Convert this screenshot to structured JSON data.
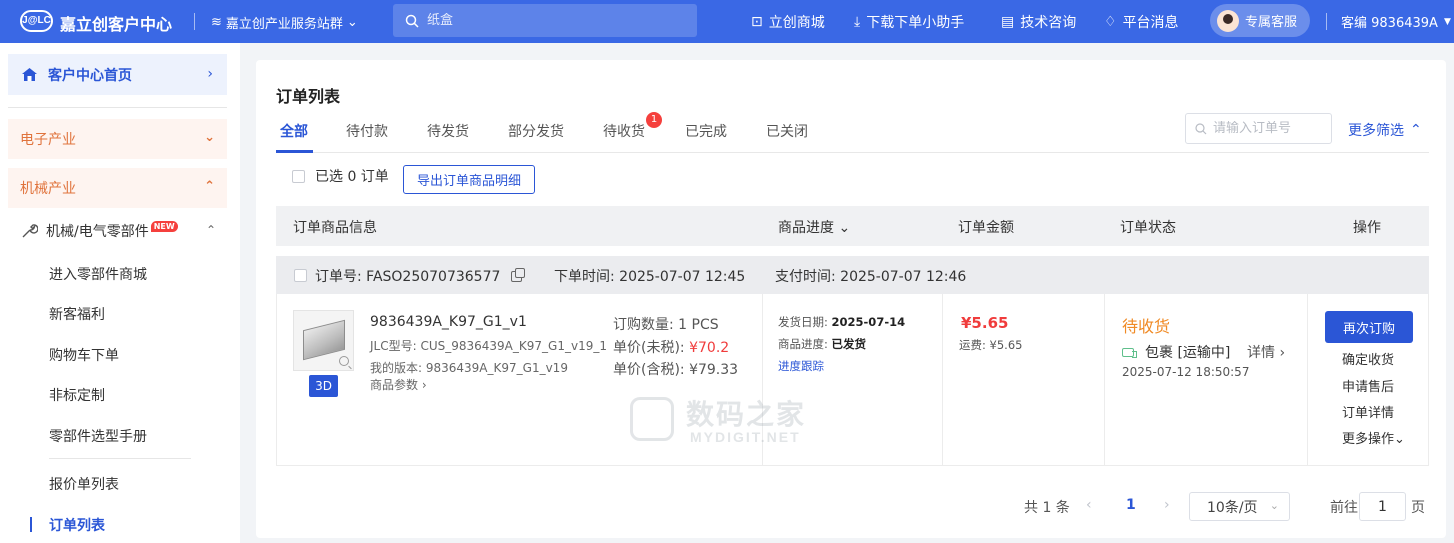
{
  "topbar": {
    "logo_text": "J@LC",
    "brand": "嘉立创客户中心",
    "site_switch": "嘉立创产业服务站群",
    "search_placeholder": "纸盒",
    "nav": [
      "立创商城",
      "下载下单小助手",
      "技术咨询",
      "平台消息"
    ],
    "service": "专属客服",
    "account": "客编 9836439A"
  },
  "sidebar": {
    "home": "客户中心首页",
    "categories": [
      "电子产业",
      "机械产业"
    ],
    "group": "机械/电气零部件",
    "new_badge": "NEW",
    "items": [
      "进入零部件商城",
      "新客福利",
      "购物车下单",
      "非标定制",
      "零部件选型手册"
    ],
    "items2": [
      "报价单列表",
      "订单列表"
    ]
  },
  "main": {
    "title": "订单列表",
    "tabs": [
      "全部",
      "待付款",
      "待发货",
      "部分发货",
      "待收货",
      "已完成",
      "已关闭"
    ],
    "tab_badge": "1",
    "order_search_placeholder": "请输入订单号",
    "more_filter": "更多筛选",
    "selected": "已选 0 订单",
    "export": "导出订单商品明细",
    "columns": [
      "订单商品信息",
      "商品进度",
      "订单金额",
      "订单状态",
      "操作"
    ]
  },
  "order": {
    "no_label": "订单号:",
    "no": "FASO25070736577",
    "placed_label": "下单时间:",
    "placed": "2025-07-07 12:45",
    "paid_label": "支付时间:",
    "paid": "2025-07-07 12:46",
    "badge_3d": "3D",
    "product_name": "9836439A_K97_G1_v1",
    "jlc_model": "JLC型号: CUS_9836439A_K97_G1_v19_1",
    "my_version": "我的版本: 9836439A_K97_G1_v19",
    "params": "商品参数 ›",
    "qty": "订购数量: 1 PCS",
    "unit_pre_label": "单价(未税):",
    "unit_pre": "¥70.2",
    "unit_tax": "单价(含税): ¥79.33",
    "ship_date_label": "发货日期:",
    "ship_date": "2025-07-14",
    "progress_label": "商品进度:",
    "progress": "已发货",
    "track": "进度跟踪",
    "amount": "¥5.65",
    "freight": "运费: ¥5.65",
    "status": "待收货",
    "logistics": "包裹 [运输中]",
    "detail": "详情 ›",
    "status_time": "2025-07-12 18:50:57",
    "actions": [
      "再次订购",
      "确定收货",
      "申请售后",
      "订单详情",
      "更多操作"
    ]
  },
  "pager": {
    "total": "共 1 条",
    "current": "1",
    "page_size": "10条/页",
    "goto_label": "前往",
    "goto_value": "1",
    "page_suffix": "页"
  },
  "watermark": {
    "cn": "数码之家",
    "en": "MYDIGIT.NET"
  },
  "colors": {
    "brand_blue": "#3a68e5",
    "link_blue": "#2b56d6",
    "price_red": "#f03c3c",
    "status_orange": "#f08a24"
  }
}
